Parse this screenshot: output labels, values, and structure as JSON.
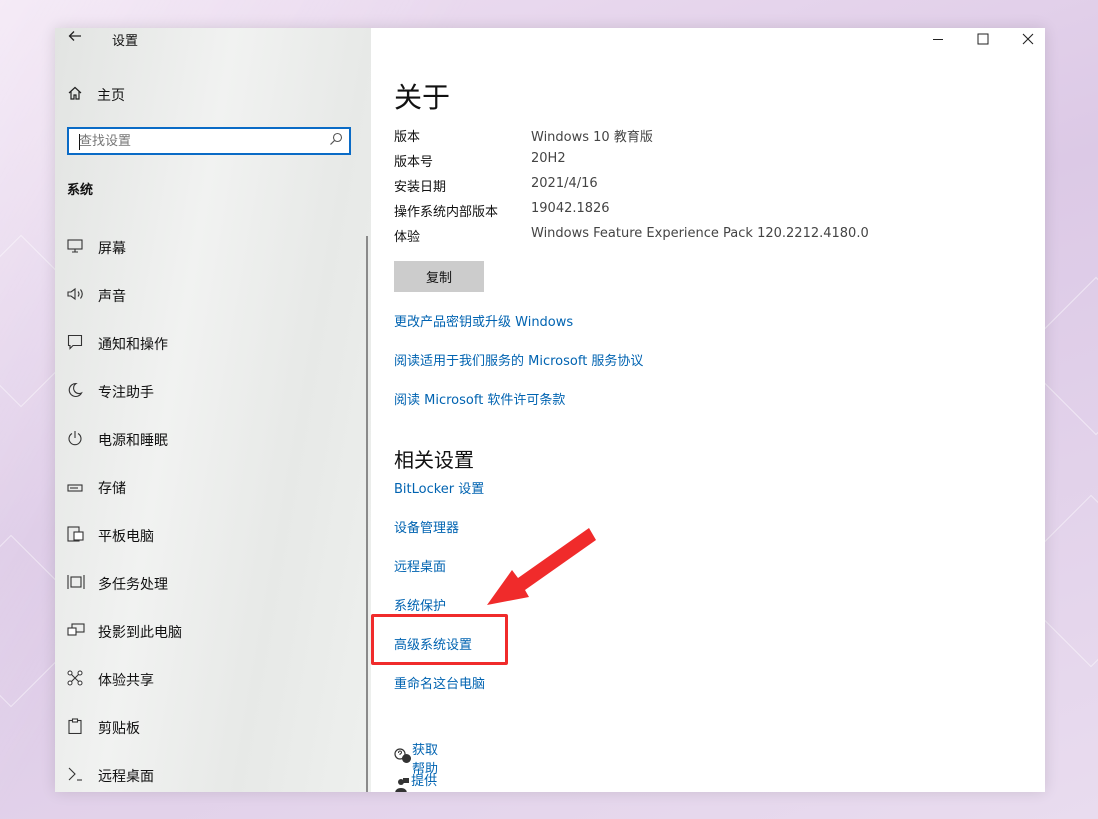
{
  "sidebar": {
    "back_icon": "back-arrow-icon",
    "title": "设置",
    "home_label": "主页",
    "search_placeholder": "查找设置",
    "section_label": "系统",
    "items": [
      {
        "label": "屏幕",
        "icon": "monitor-icon"
      },
      {
        "label": "声音",
        "icon": "speaker-icon"
      },
      {
        "label": "通知和操作",
        "icon": "notification-icon"
      },
      {
        "label": "专注助手",
        "icon": "moon-icon"
      },
      {
        "label": "电源和睡眠",
        "icon": "power-icon"
      },
      {
        "label": "存储",
        "icon": "storage-icon"
      },
      {
        "label": "平板电脑",
        "icon": "tablet-icon"
      },
      {
        "label": "多任务处理",
        "icon": "multitask-icon"
      },
      {
        "label": "投影到此电脑",
        "icon": "project-icon"
      },
      {
        "label": "体验共享",
        "icon": "share-icon"
      },
      {
        "label": "剪贴板",
        "icon": "clipboard-icon"
      },
      {
        "label": "远程桌面",
        "icon": "remote-desktop-icon"
      }
    ]
  },
  "window_controls": [
    "minimize-icon",
    "maximize-icon",
    "close-icon"
  ],
  "main": {
    "title": "关于",
    "specs": [
      {
        "key": "版本",
        "value": "Windows 10 教育版"
      },
      {
        "key": "版本号",
        "value": "20H2"
      },
      {
        "key": "安装日期",
        "value": "2021/4/16"
      },
      {
        "key": "操作系统内部版本",
        "value": "19042.1826"
      },
      {
        "key": "体验",
        "value": "Windows Feature Experience Pack 120.2212.4180.0"
      }
    ],
    "copy_label": "复制",
    "links": [
      "更改产品密钥或升级 Windows",
      "阅读适用于我们服务的 Microsoft 服务协议",
      "阅读 Microsoft 软件许可条款"
    ],
    "related_title": "相关设置",
    "related_links": [
      "BitLocker 设置",
      "设备管理器",
      "远程桌面",
      "系统保护",
      "高级系统设置",
      "重命名这台电脑"
    ],
    "help_links": [
      {
        "label": "获取帮助",
        "icon": "help-chat-icon"
      },
      {
        "label": "提供反馈",
        "icon": "feedback-icon"
      }
    ]
  },
  "annotation": {
    "color": "#f02b2b",
    "highlight_target": "高级系统设置"
  },
  "colors": {
    "link": "#0063b1",
    "accent": "#0a6bc6"
  }
}
